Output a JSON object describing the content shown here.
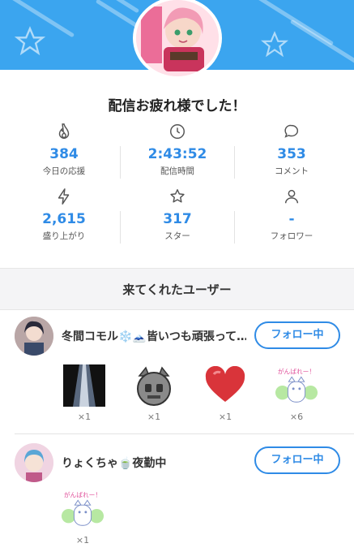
{
  "header": {
    "title": "配信お疲れ様でした！",
    "banner_color": "#3ba5ef",
    "accent_color": "#2f8be6"
  },
  "stats": [
    {
      "icon": "flame-icon",
      "value": "384",
      "label": "今日の応援"
    },
    {
      "icon": "clock-icon",
      "value": "2:43:52",
      "label": "配信時間"
    },
    {
      "icon": "comment-icon",
      "value": "353",
      "label": "コメント"
    },
    {
      "icon": "lightning-icon",
      "value": "2,615",
      "label": "盛り上がり"
    },
    {
      "icon": "star-icon",
      "value": "317",
      "label": "スター"
    },
    {
      "icon": "person-icon",
      "value": "-",
      "label": "フォロワー"
    }
  ],
  "visitors": {
    "heading": "来てくれたユーザー",
    "users": [
      {
        "name": "冬間コモル❄️🗻皆いつも頑張って…",
        "follow_label": "フォロー中",
        "gifts": [
          {
            "icon": "spotlight-icon",
            "count": "×1"
          },
          {
            "icon": "robot-cat-icon",
            "count": "×1"
          },
          {
            "icon": "heart-icon",
            "count": "×1"
          },
          {
            "icon": "cheer-cat-icon",
            "count": "×6"
          }
        ]
      },
      {
        "name": "りょくちゃ🍵夜勤中",
        "follow_label": "フォロー中",
        "gifts": [
          {
            "icon": "cheer-cat-icon",
            "count": "×1"
          }
        ]
      }
    ]
  },
  "gift_text": {
    "cheer": "がんばれー！"
  }
}
